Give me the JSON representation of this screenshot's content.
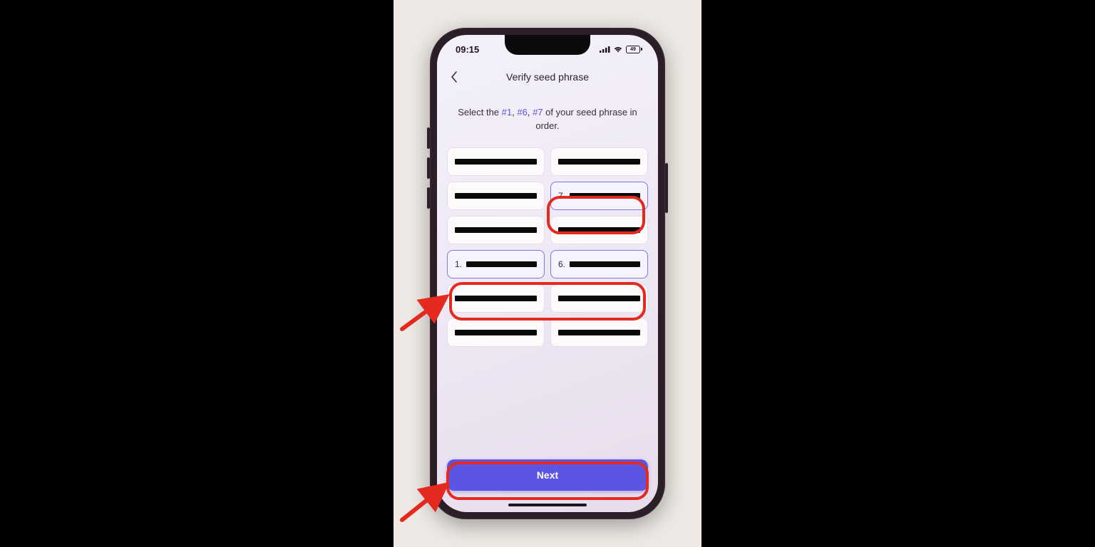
{
  "status": {
    "time": "09:15",
    "battery_level": "49"
  },
  "nav": {
    "title": "Verify seed phrase"
  },
  "instruction": {
    "prefix": "Select the ",
    "index1": "#1",
    "sep1": ", ",
    "index2": "#6",
    "sep2": ", ",
    "index3": "#7",
    "suffix": " of your seed phrase in order."
  },
  "chips": [
    {
      "selected": false,
      "label": ""
    },
    {
      "selected": false,
      "label": ""
    },
    {
      "selected": false,
      "label": ""
    },
    {
      "selected": true,
      "label": "7."
    },
    {
      "selected": false,
      "label": ""
    },
    {
      "selected": false,
      "label": ""
    },
    {
      "selected": true,
      "label": "1."
    },
    {
      "selected": true,
      "label": "6."
    },
    {
      "selected": false,
      "label": ""
    },
    {
      "selected": false,
      "label": ""
    },
    {
      "selected": false,
      "label": ""
    },
    {
      "selected": false,
      "label": ""
    }
  ],
  "actions": {
    "next_label": "Next"
  },
  "colors": {
    "accent": "#5a55e2",
    "highlight": "#e42a1f"
  }
}
